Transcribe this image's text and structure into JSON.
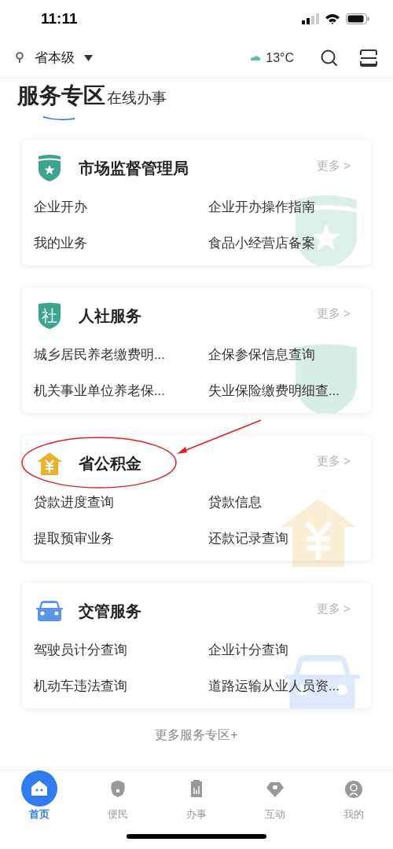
{
  "status_bar": {
    "time": "11:11"
  },
  "header": {
    "location": "省本级",
    "weather": "13°C"
  },
  "section": {
    "title": "服务专区",
    "subtitle": "在线办事"
  },
  "cards": [
    {
      "kind": "market",
      "title": "市场监督管理局",
      "more": "更多 >",
      "items": [
        "企业开办",
        "企业开办操作指南",
        "我的业务",
        "食品小经营店备案"
      ]
    },
    {
      "kind": "social",
      "title": "人社服务",
      "badge_char": "社",
      "more": "更多 >",
      "items": [
        "城乡居民养老缴费明...",
        "企保参保信息查询",
        "机关事业单位养老保...",
        "失业保险缴费明细查..."
      ]
    },
    {
      "kind": "fund",
      "title": "省公积金",
      "more": "更多 >",
      "annotated": true,
      "items": [
        "贷款进度查询",
        "贷款信息",
        "提取预审业务",
        "还款记录查询"
      ]
    },
    {
      "kind": "traffic",
      "title": "交管服务",
      "more": "更多 >",
      "items": [
        "驾驶员计分查询",
        "企业计分查询",
        "机动车违法查询",
        "道路运输从业人员资..."
      ]
    }
  ],
  "more_zones": "更多服务专区+",
  "tabs": [
    {
      "label": "首页",
      "selected": true
    },
    {
      "label": "便民",
      "selected": false
    },
    {
      "label": "办事",
      "selected": false
    },
    {
      "label": "互动",
      "selected": false
    },
    {
      "label": "我的",
      "selected": false
    }
  ]
}
